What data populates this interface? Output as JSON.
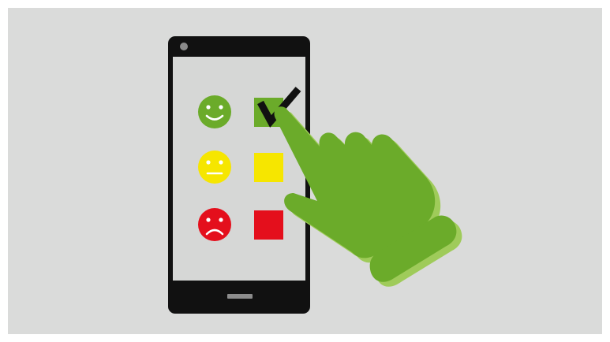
{
  "colors": {
    "outer_border": "#ffffff",
    "background": "#dadbda",
    "phone_body": "#111111",
    "phone_screen": "#d6d7d6",
    "camera": "#8a8a8a",
    "home_button": "#8c8c8c",
    "happy": "#6bab2a",
    "neutral": "#f6e600",
    "sad": "#e40f1c",
    "hand": "#6bab2a",
    "hand_shadow": "#9fcb5a",
    "checkmark": "#111111"
  },
  "survey": {
    "rows": [
      {
        "mood": "happy",
        "icon": "smiley-happy-icon",
        "checked": true
      },
      {
        "mood": "neutral",
        "icon": "smiley-neutral-icon",
        "checked": false
      },
      {
        "mood": "sad",
        "icon": "smiley-sad-icon",
        "checked": false
      }
    ]
  },
  "hand_icon": "pointing-hand-icon"
}
